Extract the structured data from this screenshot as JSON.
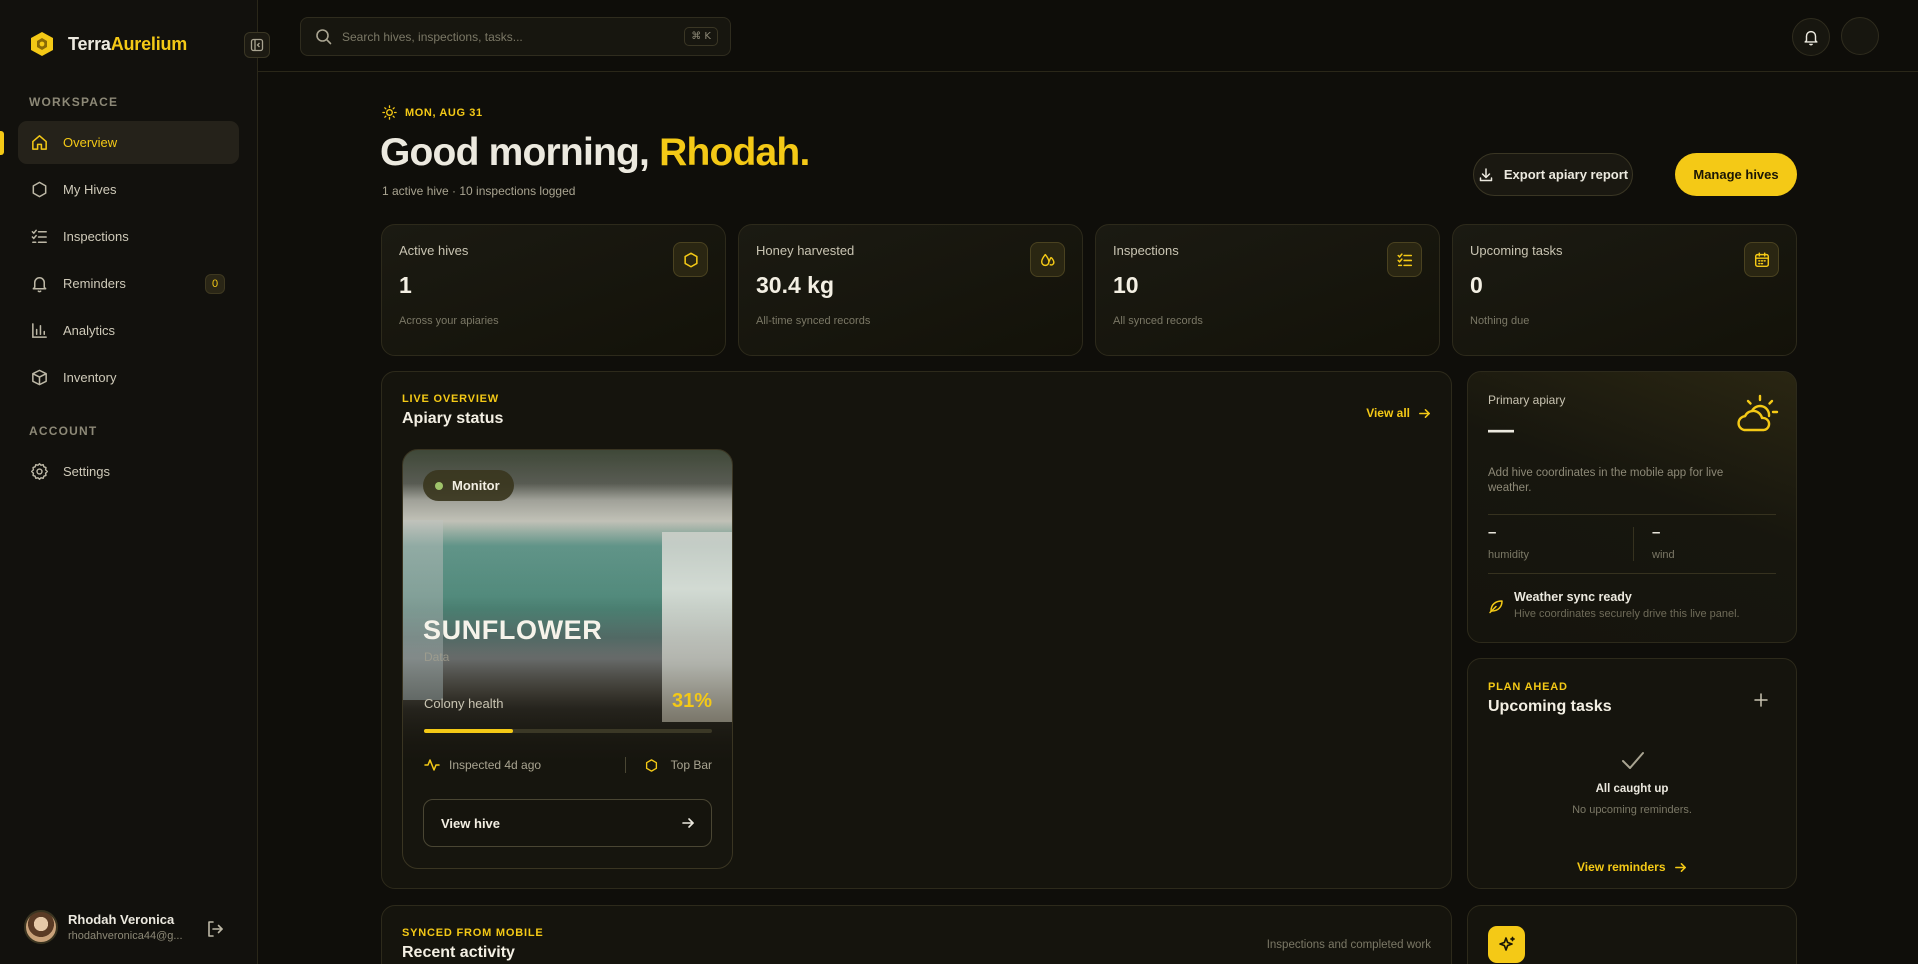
{
  "brand": {
    "name_part1": "Terra",
    "name_part2": "Aurelium"
  },
  "sidebar": {
    "workspace_label": "WORKSPACE",
    "account_label": "ACCOUNT",
    "items": [
      {
        "label": "Overview",
        "icon": "home-icon"
      },
      {
        "label": "My Hives",
        "icon": "hexagon-icon"
      },
      {
        "label": "Inspections",
        "icon": "checklist-icon"
      },
      {
        "label": "Reminders",
        "icon": "bell-icon",
        "badge": "0"
      },
      {
        "label": "Analytics",
        "icon": "bar-chart-icon"
      },
      {
        "label": "Inventory",
        "icon": "box-icon"
      }
    ],
    "settings_label": "Settings",
    "user": {
      "name": "Rhodah Veronica",
      "email": "rhodahveronica44@g..."
    }
  },
  "topbar": {
    "search_placeholder": "Search hives, inspections, tasks...",
    "shortcut": "⌘ K"
  },
  "header": {
    "date": "MON, AUG 31",
    "greeting": "Good morning,",
    "name": "Rhodah.",
    "subline": "1 active hive · 10 inspections logged",
    "export_label": "Export apiary report",
    "manage_label": "Manage hives"
  },
  "stats": [
    {
      "title": "Active hives",
      "value": "1",
      "sub": "Across your apiaries",
      "icon": "hexagon-icon"
    },
    {
      "title": "Honey harvested",
      "value": "30.4 kg",
      "sub": "All-time synced records",
      "icon": "drops-icon"
    },
    {
      "title": "Inspections",
      "value": "10",
      "sub": "All synced records",
      "icon": "checklist-icon"
    },
    {
      "title": "Upcoming tasks",
      "value": "0",
      "sub": "Nothing due",
      "icon": "calendar-icon"
    }
  ],
  "apiary": {
    "eyebrow": "LIVE OVERVIEW",
    "title": "Apiary status",
    "view_all": "View all",
    "hive": {
      "status": "Monitor",
      "name": "SUNFLOWER",
      "sub": "Data",
      "health_label": "Colony health",
      "health_value": "31%",
      "health_fraction": 0.31,
      "inspected": "Inspected 4d ago",
      "type": "Top Bar",
      "view_label": "View hive"
    }
  },
  "weather": {
    "label": "Primary apiary",
    "value": "—",
    "note": "Add hive coordinates in the mobile app for live weather.",
    "humidity_value": "–",
    "humidity_label": "humidity",
    "wind_value": "–",
    "wind_label": "wind",
    "sync_title": "Weather sync ready",
    "sync_sub": "Hive coordinates securely drive this live panel."
  },
  "tasks": {
    "eyebrow": "PLAN AHEAD",
    "title": "Upcoming tasks",
    "empty_title": "All caught up",
    "empty_sub": "No upcoming reminders.",
    "link": "View reminders"
  },
  "activity": {
    "eyebrow": "SYNCED FROM MOBILE",
    "title": "Recent activity",
    "note": "Inspections and completed work"
  },
  "colors": {
    "accent": "#f4c916",
    "background": "#0f0e0a"
  }
}
